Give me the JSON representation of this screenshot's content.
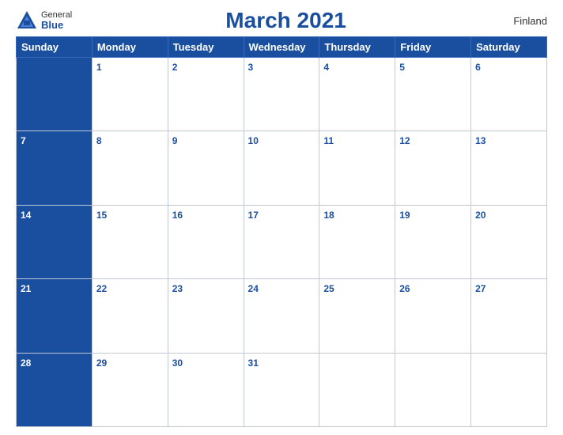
{
  "header": {
    "title": "March 2021",
    "country": "Finland",
    "logo_general": "General",
    "logo_blue": "Blue"
  },
  "weekdays": [
    "Sunday",
    "Monday",
    "Tuesday",
    "Wednesday",
    "Thursday",
    "Friday",
    "Saturday"
  ],
  "weeks": [
    [
      null,
      1,
      2,
      3,
      4,
      5,
      6
    ],
    [
      7,
      8,
      9,
      10,
      11,
      12,
      13
    ],
    [
      14,
      15,
      16,
      17,
      18,
      19,
      20
    ],
    [
      21,
      22,
      23,
      24,
      25,
      26,
      27
    ],
    [
      28,
      29,
      30,
      31,
      null,
      null,
      null
    ]
  ],
  "accent_color": "#1a4fa0"
}
